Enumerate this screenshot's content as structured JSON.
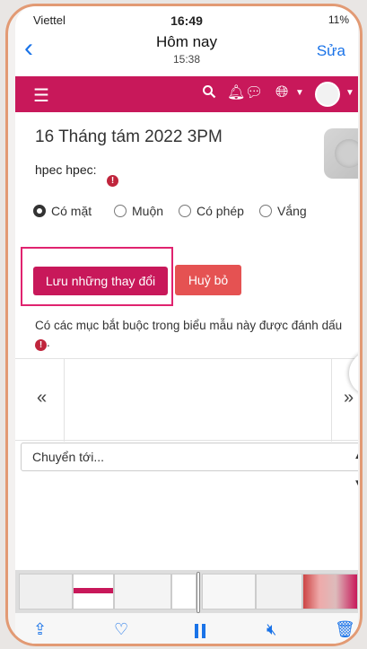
{
  "status_bar": {
    "carrier": "Viettel",
    "time": "16:49",
    "battery": "11%"
  },
  "nav": {
    "title": "Hôm nay",
    "subtitle": "15:38",
    "edit_label": "Sửa"
  },
  "appbar": {
    "colors": {
      "brand": "#c8185a"
    }
  },
  "session": {
    "date_title": "16 Tháng tám 2022 3PM",
    "user_label": "hpec hpec:"
  },
  "attendance": {
    "options": [
      "Có mặt",
      "Muộn",
      "Có phép",
      "Vắng"
    ],
    "selected": "Có mặt"
  },
  "actions": {
    "save_label": "Lưu những thay đổi",
    "cancel_label": "Huỷ bỏ"
  },
  "notice": {
    "required_text": "Có các mục bắt buộc trong biểu mẫu này được đánh dấu",
    "suffix": "."
  },
  "pager": {
    "prev": "«",
    "next": "»"
  },
  "jump": {
    "selected": "Chuyển tới..."
  },
  "icons": [
    "chevron-left-icon",
    "menu-icon",
    "search-icon",
    "bell-icon",
    "chat-icon",
    "globe-icon",
    "avatar",
    "alert-icon",
    "share-icon",
    "heart-icon",
    "pause-icon",
    "mute-icon",
    "trash-icon"
  ]
}
